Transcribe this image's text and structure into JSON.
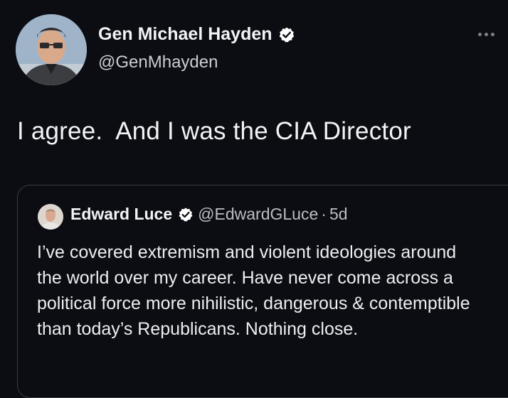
{
  "tweet": {
    "author_name": "Gen Michael Hayden",
    "author_handle": "@GenMhayden",
    "text": "I agree.  And I was the CIA Director"
  },
  "quoted_tweet": {
    "author_name": "Edward Luce",
    "author_handle": "@EdwardGLuce",
    "separator": "·",
    "time": "5d",
    "text": "I’ve covered extremism and violent ideologies around the world over my career. Have never come across a political force more nihilistic, dangerous & contemptible than today’s Republicans. Nothing close."
  },
  "colors": {
    "background": "#0b0d12",
    "text": "#f2f3f5",
    "secondary_text": "#c9ccd1",
    "border": "#3a3e45",
    "verified_badge": "#ffffff"
  },
  "icons": {
    "verified": "verified-badge-icon",
    "more": "more-options-icon"
  }
}
